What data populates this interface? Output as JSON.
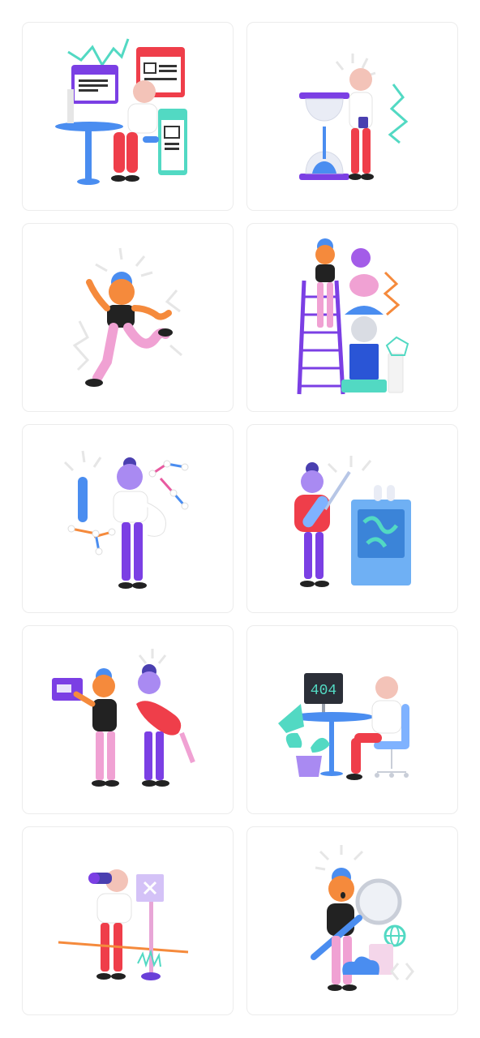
{
  "gallery": {
    "cards": [
      {
        "illustration": "person-at-desk-with-computer-and-browser-windows"
      },
      {
        "illustration": "person-beside-hourglass-holding-phone"
      },
      {
        "illustration": "person-dancing-with-energy-lines"
      },
      {
        "illustration": "person-on-ladder-stacking-shapes"
      },
      {
        "illustration": "person-with-test-tube-and-molecules"
      },
      {
        "illustration": "person-with-syringe-and-machine"
      },
      {
        "illustration": "two-people-with-box-and-pencil"
      },
      {
        "illustration": "person-at-desk-404-screen-and-plant"
      },
      {
        "illustration": "person-with-binoculars-and-x-sign"
      },
      {
        "illustration": "person-with-magnifying-glass-and-globe"
      }
    ],
    "text_404": "404"
  },
  "colors": {
    "purple": "#7b3fe4",
    "red": "#ef3e4a",
    "teal": "#52d9c3",
    "blue": "#4a8df0",
    "pink": "#f0a1d3",
    "orange": "#f58a3c",
    "skin": "#f3c3b8",
    "violet_skin": "#a98af2"
  }
}
